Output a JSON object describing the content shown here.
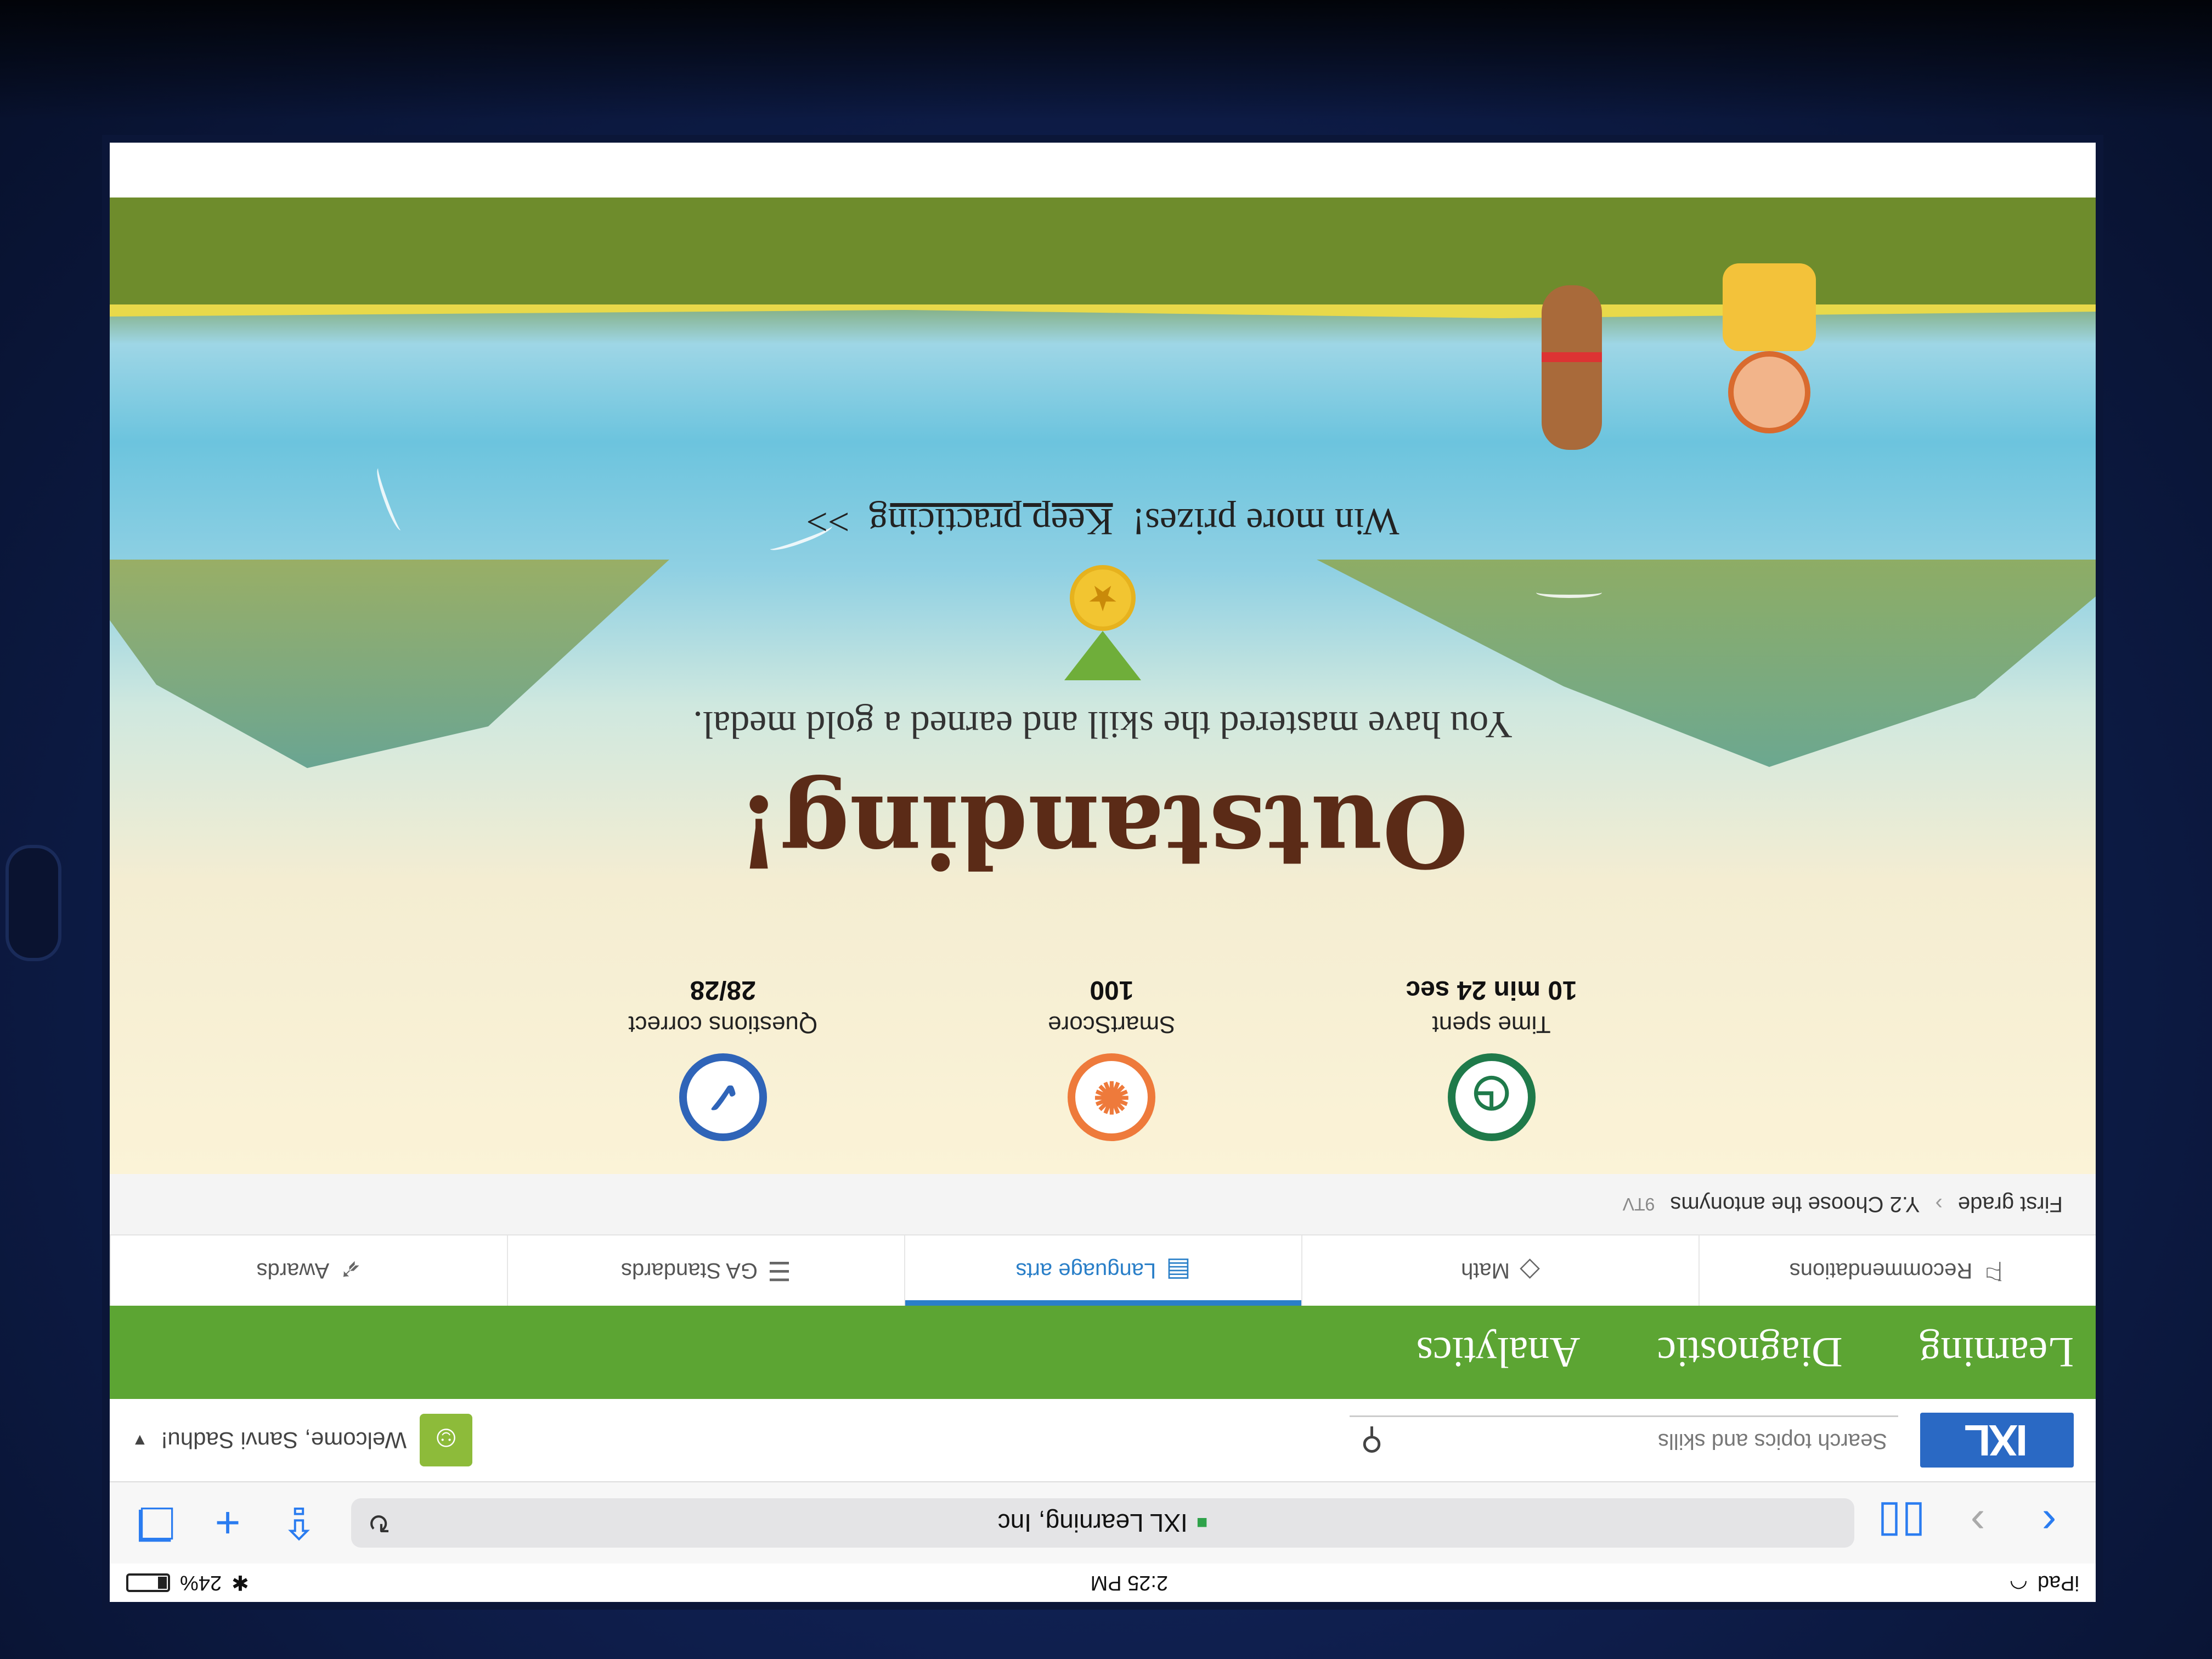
{
  "status_bar": {
    "device": "iPad",
    "time": "2:25 PM",
    "battery": "24%",
    "battery_level": 0.24
  },
  "browser": {
    "url_text": "IXL Learning, Inc"
  },
  "ixl_header": {
    "logo": "IXL",
    "search_placeholder": "Search topics and skills",
    "welcome": "Welcome, Sanvi Sadhu!"
  },
  "main_nav": {
    "tabs": [
      "Learning",
      "Diagnostic",
      "Analytics"
    ]
  },
  "sub_nav": {
    "items": [
      {
        "label": "Recommendations",
        "icon": "recommendations-icon"
      },
      {
        "label": "Math",
        "icon": "diamond-icon"
      },
      {
        "label": "Language arts",
        "icon": "book-icon",
        "active": true
      },
      {
        "label": "GA Standards",
        "icon": "list-icon"
      },
      {
        "label": "Awards",
        "icon": "rocket-icon"
      }
    ]
  },
  "breadcrumb": {
    "grade": "First grade",
    "skill": "Y.2 Choose the antonyms",
    "code": "9TV"
  },
  "stats": [
    {
      "label": "Time spent",
      "value": "10 min  24 sec",
      "icon": "clock-icon",
      "color": "#1f7a4a"
    },
    {
      "label": "SmartScore",
      "value": "100",
      "icon": "lightbulb-icon",
      "color": "#ee7a3b"
    },
    {
      "label": "Questions correct",
      "value": "28/28",
      "icon": "checkmark-icon",
      "color": "#2f64b8"
    }
  ],
  "celebration": {
    "headline": "Outstanding!",
    "subtext": "You have mastered the skill and earned a gold medal.",
    "prize_text": "Win more prizes!",
    "prize_link": "Keep practicing",
    "prize_arrow": ">>"
  }
}
